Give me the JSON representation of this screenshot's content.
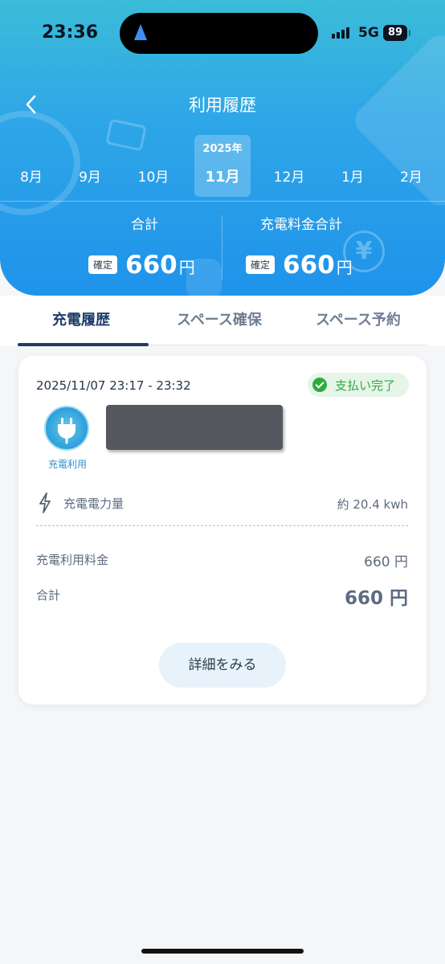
{
  "status_bar": {
    "time": "23:36",
    "network": "5G",
    "battery": "89"
  },
  "header": {
    "title": "利用履歴"
  },
  "months": {
    "year": "2025年",
    "items": [
      "8月",
      "9月",
      "10月",
      "11月",
      "12月",
      "1月",
      "2月"
    ],
    "selected": "11月"
  },
  "summary": {
    "total_label": "合計",
    "charge_total_label": "充電料金合計",
    "confirmed_badge": "確定",
    "total_amount": "660",
    "charge_total_amount": "660",
    "currency": "円"
  },
  "tabs": [
    "充電履歴",
    "スペース確保",
    "スペース予約"
  ],
  "record": {
    "datetime": "2025/11/07 23:17 - 23:32",
    "status": "支払い完了",
    "type_label": "充電利用",
    "energy_label": "充電電力量",
    "energy_value": "約 20.4 kwh",
    "fee_label": "充電利用料金",
    "fee_value": "660 円",
    "total_label": "合計",
    "total_value": "660 円",
    "detail_button": "詳細をみる"
  },
  "colors": {
    "accent": "#1f93ea",
    "success": "#2eaa41",
    "tab_active": "#1f3d66"
  }
}
